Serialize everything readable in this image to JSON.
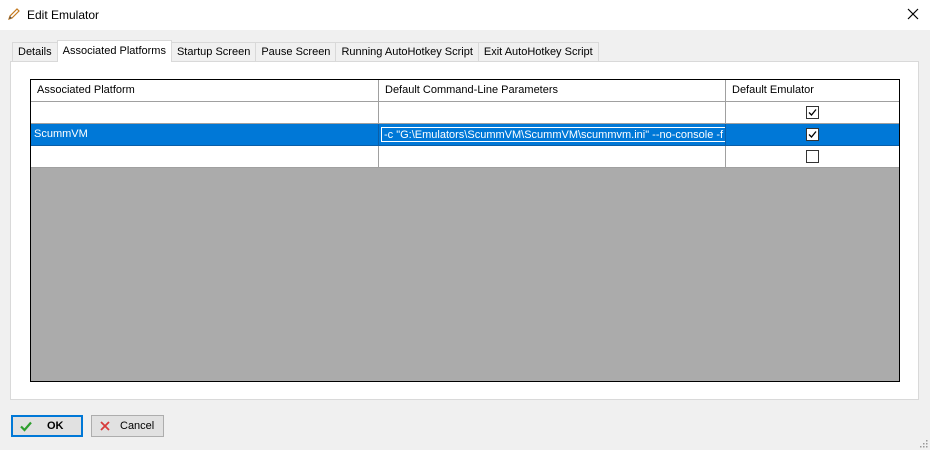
{
  "window": {
    "title": "Edit Emulator"
  },
  "tabs": [
    {
      "label": "Details",
      "active": false
    },
    {
      "label": "Associated Platforms",
      "active": true
    },
    {
      "label": "Startup Screen",
      "active": false
    },
    {
      "label": "Pause Screen",
      "active": false
    },
    {
      "label": "Running AutoHotkey Script",
      "active": false
    },
    {
      "label": "Exit AutoHotkey Script",
      "active": false
    }
  ],
  "grid": {
    "columns": [
      "Associated Platform",
      "Default Command-Line Parameters",
      "Default Emulator"
    ],
    "rows": [
      {
        "platform": "",
        "params": "",
        "default": true,
        "selected": false
      },
      {
        "platform": "ScummVM",
        "params": "-c \"G:\\Emulators\\ScummVM\\ScummVM\\scummvm.ini\" --no-console -f",
        "default": true,
        "selected": true
      },
      {
        "platform": "",
        "params": "",
        "default": false,
        "selected": false
      }
    ]
  },
  "buttons": {
    "ok": "OK",
    "cancel": "Cancel"
  },
  "icons": {
    "title": "pencil-icon",
    "close": "close-icon",
    "ok": "checkmark-icon",
    "cancel": "x-icon"
  },
  "colors": {
    "selection": "#0078d7",
    "grid_empty": "#ababab",
    "ok_check": "#2e9e2e",
    "cancel_x": "#d83a3a"
  }
}
